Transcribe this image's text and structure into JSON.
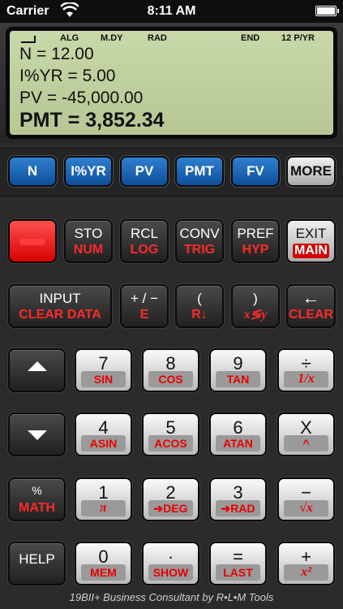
{
  "status_bar": {
    "carrier": "Carrier",
    "time": "8:11 AM"
  },
  "display": {
    "indicators": [
      "ALG",
      "M.DY",
      "RAD",
      "END",
      "12 P/YR"
    ],
    "lines": [
      "N = 12.00",
      "I%YR = 5.00",
      "PV = -45,000.00"
    ],
    "result": "PMT = 3,852.34"
  },
  "tvm_keys": [
    "N",
    "I%YR",
    "PV",
    "PMT",
    "FV"
  ],
  "more_key": "MORE",
  "row1": {
    "sto": {
      "top": "STO",
      "bottom": "NUM"
    },
    "rcl": {
      "top": "RCL",
      "bottom": "LOG"
    },
    "conv": {
      "top": "CONV",
      "bottom": "TRIG"
    },
    "pref": {
      "top": "PREF",
      "bottom": "HYP"
    },
    "exit": {
      "top": "EXIT",
      "bottom": "MAIN"
    }
  },
  "row2": {
    "input": {
      "top": "INPUT",
      "bottom": "CLEAR DATA"
    },
    "sign": {
      "top": "+ / −",
      "bottom": "E"
    },
    "open_paren": {
      "top": "(",
      "bottom": "R↓"
    },
    "close_paren": {
      "top": ")",
      "bottom": "x≶y"
    },
    "backspace": {
      "top": "←",
      "bottom": "CLEAR"
    }
  },
  "row3": {
    "k7": {
      "top": "7",
      "bottom": "SIN"
    },
    "k8": {
      "top": "8",
      "bottom": "COS"
    },
    "k9": {
      "top": "9",
      "bottom": "TAN"
    },
    "divide": {
      "top": "÷",
      "bottom": "1/x"
    }
  },
  "row4": {
    "k4": {
      "top": "4",
      "bottom": "ASIN"
    },
    "k5": {
      "top": "5",
      "bottom": "ACOS"
    },
    "k6": {
      "top": "6",
      "bottom": "ATAN"
    },
    "multiply": {
      "top": "X",
      "bottom": "^"
    }
  },
  "row5": {
    "percent": {
      "top": "%",
      "bottom": "MATH"
    },
    "k1": {
      "top": "1",
      "bottom": "π"
    },
    "k2": {
      "top": "2",
      "bottom": "➔DEG"
    },
    "k3": {
      "top": "3",
      "bottom": "➔RAD"
    },
    "minus": {
      "top": "−",
      "bottom": "√x"
    }
  },
  "row6": {
    "help": {
      "top": "HELP"
    },
    "k0": {
      "top": "0",
      "bottom": "MEM"
    },
    "dot": {
      "top": "·",
      "bottom": "SHOW"
    },
    "equals": {
      "top": "=",
      "bottom": "LAST"
    },
    "plus": {
      "top": "+",
      "bottom": "x²"
    }
  },
  "footer": "19BII+ Business Consultant by R•L•M Tools",
  "colors": {
    "accent_blue": "#1f69b8",
    "shift_red": "#ff2a2a",
    "lcd": "#c2d3a2"
  }
}
